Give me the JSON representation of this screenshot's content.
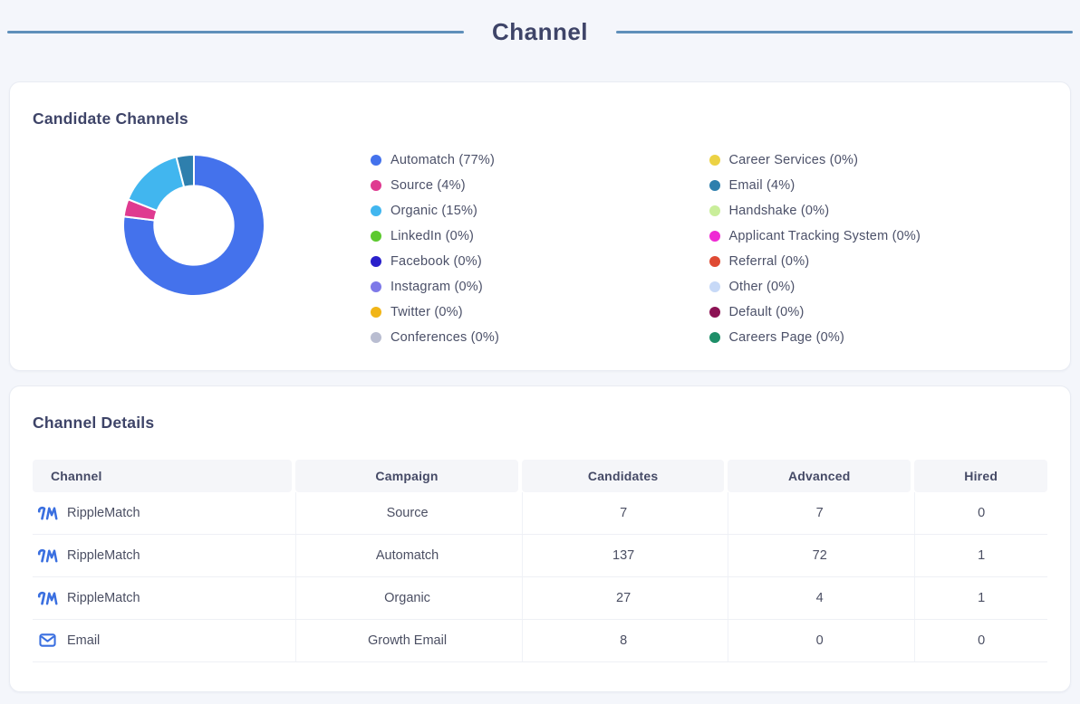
{
  "page": {
    "title": "Channel"
  },
  "cards": {
    "channels": {
      "heading": "Candidate Channels"
    },
    "details": {
      "heading": "Channel Details"
    }
  },
  "chart_data": {
    "type": "pie",
    "subtype": "donut",
    "title": "Candidate Channels",
    "inner_radius_ratio": 0.56,
    "start_angle_deg": 0,
    "direction": "clockwise",
    "legend_position": "right",
    "legend_columns": 2,
    "slices": [
      {
        "label": "Automatch",
        "pct": 77,
        "color": "#4472ec"
      },
      {
        "label": "Source",
        "pct": 4,
        "color": "#df3a90"
      },
      {
        "label": "Organic",
        "pct": 15,
        "color": "#41b6ef"
      },
      {
        "label": "LinkedIn",
        "pct": 0,
        "color": "#5cc92e"
      },
      {
        "label": "Facebook",
        "pct": 0,
        "color": "#2a20cb"
      },
      {
        "label": "Instagram",
        "pct": 0,
        "color": "#7e79e8"
      },
      {
        "label": "Twitter",
        "pct": 0,
        "color": "#f1b517"
      },
      {
        "label": "Conferences",
        "pct": 0,
        "color": "#b9bdd1"
      },
      {
        "label": "Career Services",
        "pct": 0,
        "color": "#ecd244"
      },
      {
        "label": "Email",
        "pct": 4,
        "color": "#2e7fad"
      },
      {
        "label": "Handshake",
        "pct": 0,
        "color": "#c9ee9a"
      },
      {
        "label": "Applicant Tracking System",
        "pct": 0,
        "color": "#ef29d4"
      },
      {
        "label": "Referral",
        "pct": 0,
        "color": "#df4a33"
      },
      {
        "label": "Other",
        "pct": 0,
        "color": "#c7d9f7"
      },
      {
        "label": "Default",
        "pct": 0,
        "color": "#8c1254"
      },
      {
        "label": "Careers Page",
        "pct": 0,
        "color": "#1e8e68"
      }
    ]
  },
  "table": {
    "columns": [
      "Channel",
      "Campaign",
      "Candidates",
      "Advanced",
      "Hired"
    ],
    "rows": [
      {
        "channel": "RippleMatch",
        "icon": "ripplematch-logo",
        "campaign": "Source",
        "candidates": "7",
        "advanced": "7",
        "hired": "0"
      },
      {
        "channel": "RippleMatch",
        "icon": "ripplematch-logo",
        "campaign": "Automatch",
        "candidates": "137",
        "advanced": "72",
        "hired": "1"
      },
      {
        "channel": "RippleMatch",
        "icon": "ripplematch-logo",
        "campaign": "Organic",
        "candidates": "27",
        "advanced": "4",
        "hired": "1"
      },
      {
        "channel": "Email",
        "icon": "email-envelope",
        "campaign": "Growth Email",
        "candidates": "8",
        "advanced": "0",
        "hired": "0"
      }
    ]
  },
  "colors": {
    "accent_line": "#5e8fba",
    "heading": "#3e4468",
    "logo_blue": "#3a6fe0",
    "page_background": "#f4f6fb"
  }
}
